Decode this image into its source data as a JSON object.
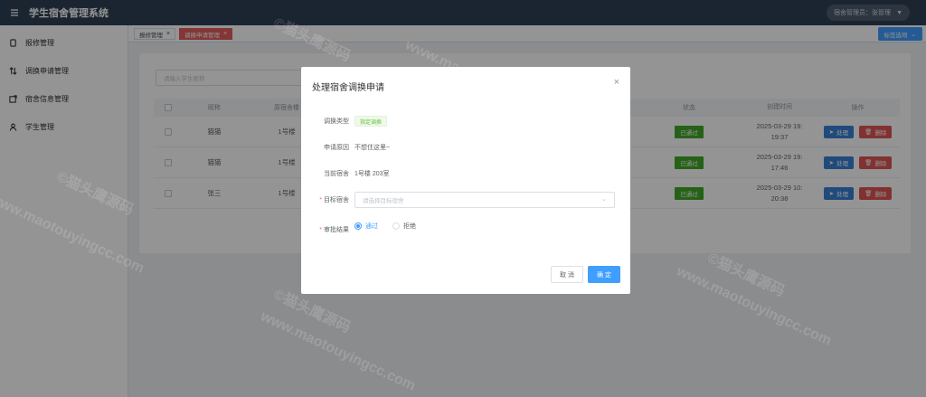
{
  "header": {
    "title": "学生宿舍管理系统",
    "user": "宿舍管理员：张管理"
  },
  "sidebar": {
    "items": [
      {
        "label": "报修管理",
        "icon": "tablet-icon"
      },
      {
        "label": "调换申请管理",
        "icon": "sort-icon"
      },
      {
        "label": "宿舍信息管理",
        "icon": "share-icon"
      },
      {
        "label": "学生管理",
        "icon": "user-icon"
      }
    ]
  },
  "tabs": {
    "items": [
      {
        "label": "报修管理"
      },
      {
        "label": "调换申请管理"
      }
    ],
    "options_label": "标签选项"
  },
  "search": {
    "placeholder": "请输入学生昵称"
  },
  "table": {
    "headers": {
      "name": "昵称",
      "building": "原宿舍楼",
      "status": "状态",
      "created": "创建时间",
      "ops": "操作"
    },
    "rows": [
      {
        "name": "猫猫",
        "building": "1号楼",
        "status": "已通过",
        "date": "2025-03-29 19:",
        "time": "19:37"
      },
      {
        "name": "猫猫",
        "building": "1号楼",
        "status": "已通过",
        "date": "2025-03-29 19:",
        "time": "17:46"
      },
      {
        "name": "张三",
        "building": "1号楼",
        "status": "已通过",
        "date": "2025-03-29 10:",
        "time": "20:38"
      }
    ],
    "edit_label": "处理",
    "delete_label": "删除"
  },
  "dialog": {
    "title": "处理宿舍调换申请",
    "type_label": "调换类型",
    "type_value": "指定调换",
    "reason_label": "申请原因",
    "reason_value": "不想住这里~",
    "current_label": "当前宿舍",
    "current_value": "1号楼 203室",
    "target_label": "目标宿舍",
    "target_placeholder": "请选择目标宿舍",
    "result_label": "审批结果",
    "result_options": [
      "通过",
      "拒绝"
    ],
    "cancel_label": "取 消",
    "confirm_label": "确 定"
  },
  "watermark": {
    "cn": "©猫头鹰源码",
    "en": "www.maotouyingcc.com"
  }
}
